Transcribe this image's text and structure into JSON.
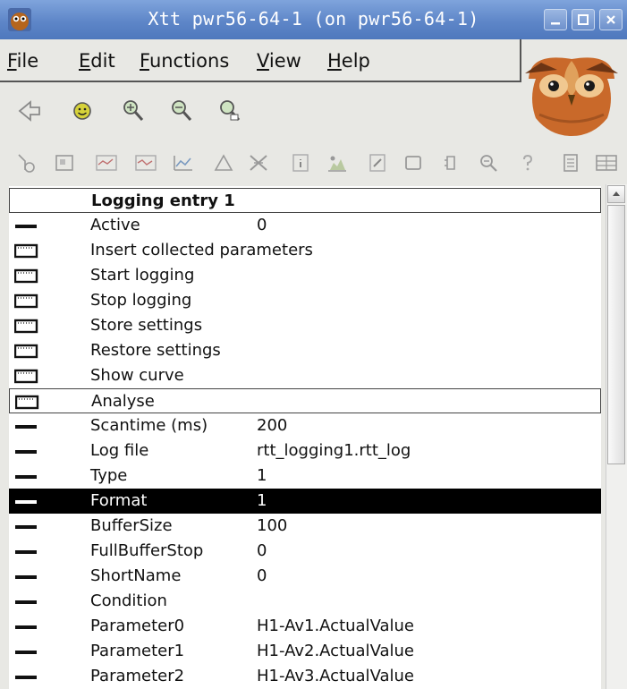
{
  "window": {
    "title": "Xtt pwr56-64-1 (on pwr56-64-1)"
  },
  "menu": [
    {
      "key": "F",
      "rest": "ile"
    },
    {
      "key": "E",
      "rest": "dit"
    },
    {
      "key": "F",
      "rest": "unctions"
    },
    {
      "key": "V",
      "rest": "iew"
    },
    {
      "key": "H",
      "rest": "elp"
    }
  ],
  "toolbar1": [
    "back-arrow-icon",
    "smiley-icon",
    "zoom-in-icon",
    "zoom-out-icon",
    "zoom-reset-icon"
  ],
  "toolbar2": [
    "open-object-icon",
    "open-graph-icon",
    "trend-icon",
    "trend-alt-icon",
    "history-icon",
    "triangle-icon",
    "crossref-icon",
    "info-icon",
    "plot-icon",
    "edit-icon",
    "window-icon",
    "bracket-icon",
    "search-icon",
    "help-icon",
    "document-icon",
    "table-icon"
  ],
  "list": {
    "header": "Logging entry 1",
    "rows": [
      {
        "name": "Active",
        "value": "0",
        "kind": "attr"
      },
      {
        "name": "Insert collected parameters",
        "value": "",
        "kind": "cmd"
      },
      {
        "name": "Start logging",
        "value": "",
        "kind": "cmd"
      },
      {
        "name": "Stop logging",
        "value": "",
        "kind": "cmd"
      },
      {
        "name": "Store settings",
        "value": "",
        "kind": "cmd"
      },
      {
        "name": "Restore settings",
        "value": "",
        "kind": "cmd"
      },
      {
        "name": "Show curve",
        "value": "",
        "kind": "cmd"
      },
      {
        "name": "Analyse",
        "value": "",
        "kind": "cmd"
      },
      {
        "name": "Scantime (ms)",
        "value": "200",
        "kind": "attr"
      },
      {
        "name": "Log file",
        "value": "rtt_logging1.rtt_log",
        "kind": "attr"
      },
      {
        "name": "Type",
        "value": "1",
        "kind": "attr"
      },
      {
        "name": "Format",
        "value": "1",
        "kind": "attr"
      },
      {
        "name": "BufferSize",
        "value": "100",
        "kind": "attr"
      },
      {
        "name": "FullBufferStop",
        "value": "0",
        "kind": "attr"
      },
      {
        "name": "ShortName",
        "value": "0",
        "kind": "attr"
      },
      {
        "name": "Condition",
        "value": "",
        "kind": "attr"
      },
      {
        "name": "Parameter0",
        "value": "H1-Av1.ActualValue",
        "kind": "attr"
      },
      {
        "name": "Parameter1",
        "value": "H1-Av2.ActualValue",
        "kind": "attr"
      },
      {
        "name": "Parameter2",
        "value": "H1-Av3.ActualValue",
        "kind": "attr"
      }
    ]
  },
  "state": {
    "selected_row": "Format",
    "outlined_row": "Analyse"
  }
}
